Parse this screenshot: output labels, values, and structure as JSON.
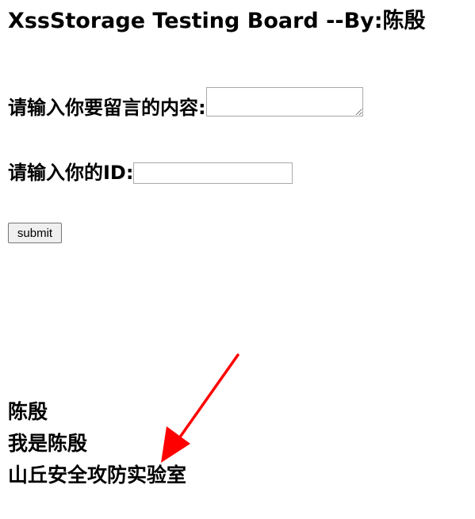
{
  "page": {
    "title": "XssStorage Testing Board --By:陈殷"
  },
  "form": {
    "message_label": "请输入你要留言的内容:",
    "message_value": "",
    "id_label": "请输入你的ID:",
    "id_value": "",
    "submit_label": "submit"
  },
  "messages": [
    "陈殷",
    "我是陈殷",
    "山丘安全攻防实验室"
  ],
  "annotation": {
    "arrow_color": "#ff0000"
  }
}
